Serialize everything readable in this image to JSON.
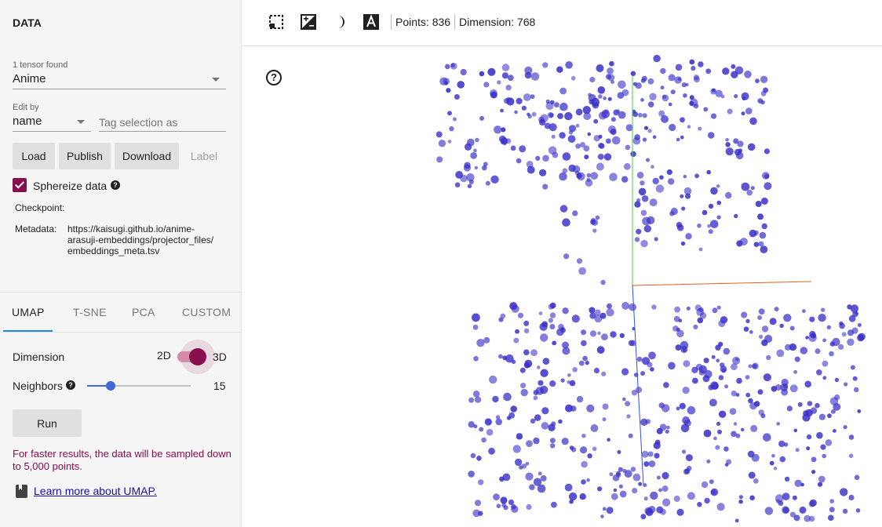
{
  "data_panel": {
    "title": "DATA",
    "tensor_count_label": "1 tensor found",
    "tensor_selected": "Anime",
    "edit_by_label": "Edit by",
    "edit_by_selected": "name",
    "tag_placeholder": "Tag selection as",
    "buttons": {
      "load": "Load",
      "publish": "Publish",
      "download": "Download",
      "label": "Label"
    },
    "sphereize_label": "Sphereize data",
    "sphereize_checked": true,
    "checkpoint_label": "Checkpoint:",
    "checkpoint_value": "",
    "metadata_label": "Metadata:",
    "metadata_line1": "https://kaisugi.github.io/anime-",
    "metadata_line2": "arasuji-embeddings/projector_files/",
    "metadata_line3": "embeddings_meta.tsv"
  },
  "projection": {
    "tabs": [
      "UMAP",
      "T-SNE",
      "PCA",
      "CUSTOM"
    ],
    "active_tab": "UMAP",
    "dimension_label": "Dimension",
    "dim_2d": "2D",
    "dim_3d": "3D",
    "dimension_3d_on": true,
    "neighbors_label": "Neighbors",
    "neighbors_value": "15",
    "neighbors_fraction": 0.18,
    "run_label": "Run",
    "warning": "For faster results, the data will be sampled down to 5,000 points.",
    "learn_more": "Learn more about UMAP."
  },
  "toolbar": {
    "icons": [
      "selection-icon",
      "night-mode-icon",
      "contrast-icon",
      "label-icon"
    ],
    "points_text": "Points: 836",
    "dimension_text": "Dimension: 768"
  },
  "scatter": {
    "help_glyph": "?",
    "point_color": "#3a30c8",
    "axis_colors": {
      "x": "#e06020",
      "y": "#40d040",
      "z": "#3050e0"
    }
  },
  "colors": {
    "accent": "#880e4f",
    "slider": "#3f6ad8",
    "link": "#1a0dab"
  }
}
